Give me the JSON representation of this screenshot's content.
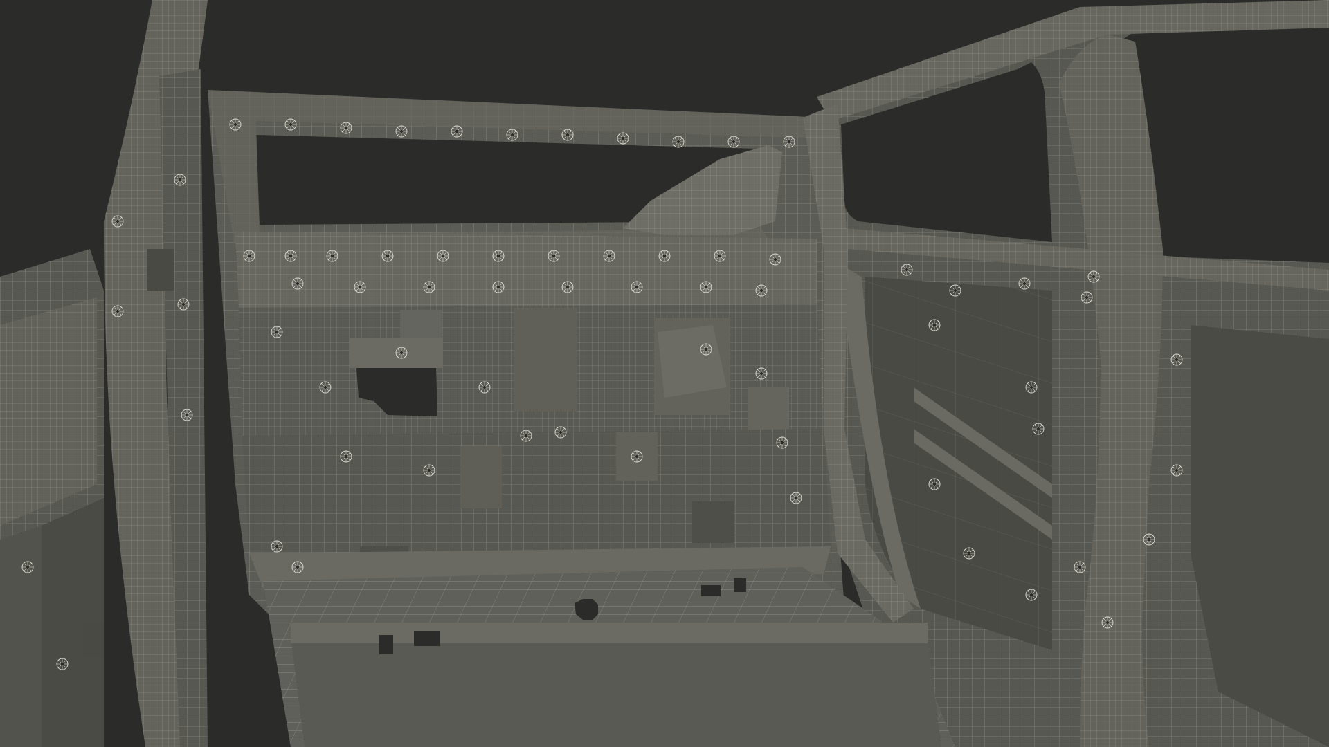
{
  "scene": {
    "subject": "",
    "colors": {
      "background": "#2b2b29",
      "panel": "#5a5a54",
      "panel_dark": "#4e4e49",
      "panel_light": "#66665f",
      "wire": "#d8d8cf",
      "wire_faint": "#a9a99f",
      "hole": "#2b2b29",
      "window_void": "#2b2b29"
    }
  }
}
